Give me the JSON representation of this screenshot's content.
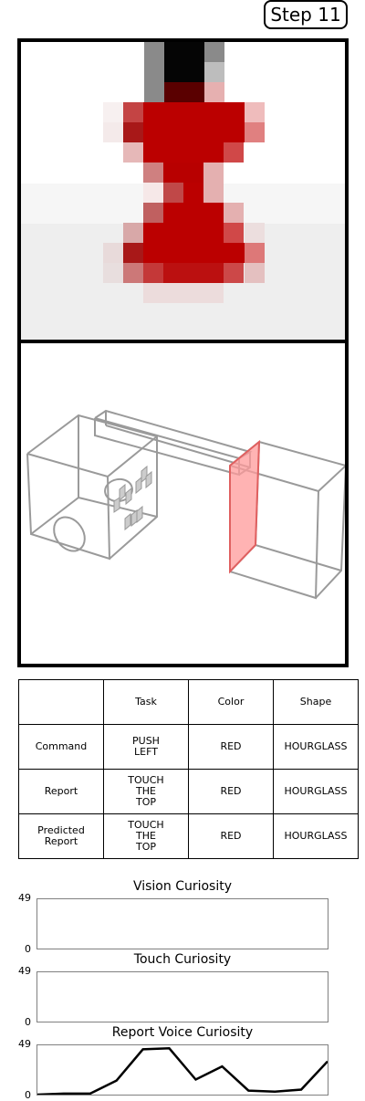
{
  "step_label": "Step 11",
  "table": {
    "headers": [
      "",
      "Task",
      "Color",
      "Shape"
    ],
    "rows": [
      {
        "label": "Command",
        "task": "PUSH\nLEFT",
        "color": "RED",
        "shape": "HOURGLASS"
      },
      {
        "label": "Report",
        "task": "TOUCH\nTHE\nTOP",
        "color": "RED",
        "shape": "HOURGLASS"
      },
      {
        "label": "Predicted\nReport",
        "task": "TOUCH\nTHE\nTOP",
        "color": "RED",
        "shape": "HOURGLASS"
      }
    ]
  },
  "chart_data": [
    {
      "type": "line",
      "title": "Vision Curiosity",
      "ylim": [
        0,
        49
      ],
      "y_ticks": [
        "49",
        "0"
      ],
      "values": []
    },
    {
      "type": "line",
      "title": "Touch Curiosity",
      "ylim": [
        0,
        49
      ],
      "y_ticks": [
        "49",
        "0"
      ],
      "values": []
    },
    {
      "type": "line",
      "title": "Report Voice Curiosity",
      "ylim": [
        0,
        49
      ],
      "y_ticks": [
        "49",
        "0"
      ],
      "x": [
        0,
        1,
        2,
        3,
        4,
        5,
        6,
        7,
        8,
        9,
        10,
        11
      ],
      "values": [
        0,
        1,
        1,
        14,
        45,
        46,
        15,
        28,
        4,
        3,
        5,
        33
      ]
    }
  ],
  "colors": {
    "highlight": "#ff9999",
    "line": "#000000",
    "frame": "#808080"
  }
}
